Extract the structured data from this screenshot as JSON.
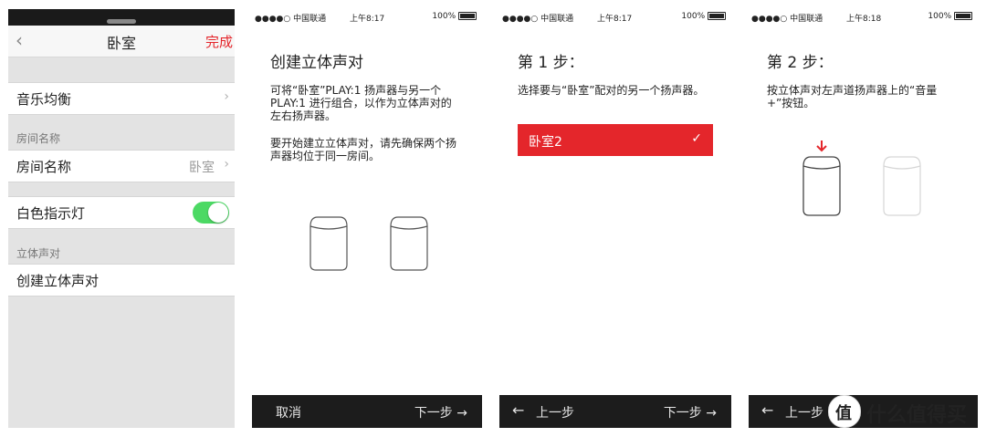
{
  "panel1": {
    "title": "卧室",
    "done_label": "完成",
    "back_icon": "chevron-left-icon",
    "rows": {
      "music_eq": "音乐均衡",
      "room_name_label": "房间名称",
      "room_name_value": "卧室",
      "white_light": "白色指示灯",
      "create_stereo": "创建立体声对"
    },
    "sections": {
      "room_name": "房间名称",
      "stereo_pair": "立体声对"
    },
    "white_light_on": true
  },
  "status": {
    "carrier": "●●●●○ 中国联通",
    "time1": "上午8:17",
    "time2": "上午8:17",
    "time3": "上午8:18",
    "battery": "100%"
  },
  "panel2": {
    "heading": "创建立体声对",
    "para1": "可将“卧室”PLAY:1 扬声器与另一个PLAY:1 进行组合，以作为立体声对的左右扬声器。",
    "para2": "要开始建立立体声对，请先确保两个扬声器均位于同一房间。",
    "cancel": "取消",
    "next": "下一步 →"
  },
  "panel3": {
    "heading": "第 1 步：",
    "para": "选择要与“卧室”配对的另一个扬声器。",
    "selected": "卧室2",
    "check": "✓",
    "prev": "上一步",
    "next": "下一步 →"
  },
  "panel4": {
    "heading": "第 2 步：",
    "para": "按立体声对左声道扬声器上的“音量+”按钮。",
    "prev": "上一步"
  },
  "watermark": {
    "text": "什么值得买",
    "logo": "值"
  },
  "colors": {
    "accent_red": "#e4262b",
    "toggle_green": "#4cd964",
    "footer_dark": "#1c1c1c"
  }
}
